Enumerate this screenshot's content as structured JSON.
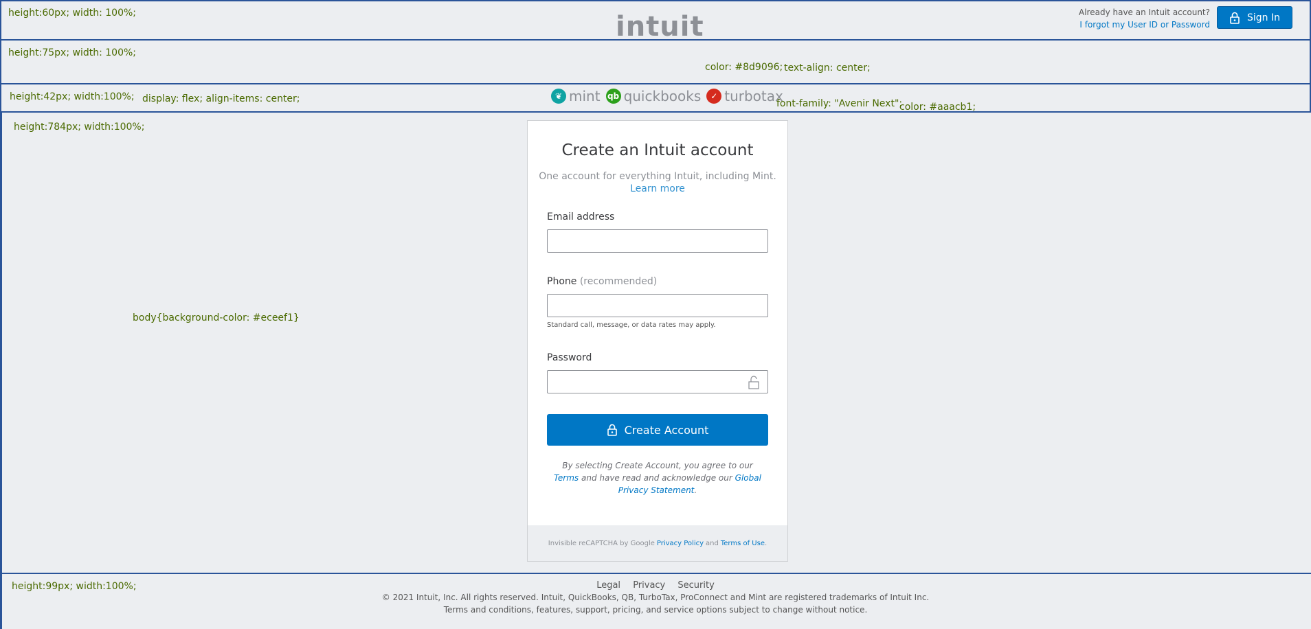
{
  "notes": {
    "band1": "height:60px; width: 100%;",
    "band2": "height:75px; width: 100%;",
    "band2_color": "color: #8d9096;",
    "band2_align": "text-align: center;",
    "band3": "height:42px; width:100%;",
    "band3_flex": "display: flex; align-items: center;",
    "band3_font": "font-family: \"Avenir Next\";",
    "band3_color": "color: #aaacb1;",
    "band4": "height:784px; width:100%;",
    "body_bg": "body{background-color: #eceef1}",
    "band5": "height:99px; width:100%;"
  },
  "header": {
    "already_text": "Already have an Intuit account?",
    "forgot_link": "I forgot my User ID or Password",
    "sign_in_label": "Sign In"
  },
  "logo": {
    "text": "intuit"
  },
  "brands": [
    {
      "name": "mint",
      "color": "#0fa3a3"
    },
    {
      "name": "quickbooks",
      "color": "#2ca01c"
    },
    {
      "name": "turbotax",
      "color": "#d52b1e"
    }
  ],
  "card": {
    "title": "Create an Intuit account",
    "subtitle": "One account for everything Intuit, including Mint.",
    "learn_more": "Learn more",
    "email_label": "Email address",
    "phone_label": "Phone",
    "phone_optional": "(recommended)",
    "phone_hint": "Standard call, message, or data rates may apply.",
    "password_label": "Password",
    "create_label": "Create Account",
    "legal_prefix": "By selecting Create Account, you agree to our",
    "terms_link": "Terms",
    "legal_middle": "and have read and acknowledge our",
    "privacy_link": "Global Privacy Statement",
    "legal_end": ".",
    "captcha_prefix": "Invisible reCAPTCHA by Google",
    "captcha_privacy": "Privacy Policy",
    "captcha_and": "and",
    "captcha_terms": "Terms of Use",
    "captcha_end": "."
  },
  "footer": {
    "links": [
      "Legal",
      "Privacy",
      "Security"
    ],
    "copyright": "© 2021 Intuit, Inc. All rights reserved. Intuit, QuickBooks, QB, TurboTax, ProConnect and Mint are registered trademarks of Intuit Inc.",
    "terms_note": "Terms and conditions, features, support, pricing, and service options subject to change without notice."
  },
  "colors": {
    "accent": "#0077c5",
    "background": "#eceef1",
    "logo_gray": "#8d9096",
    "band_border": "#2a5499"
  }
}
